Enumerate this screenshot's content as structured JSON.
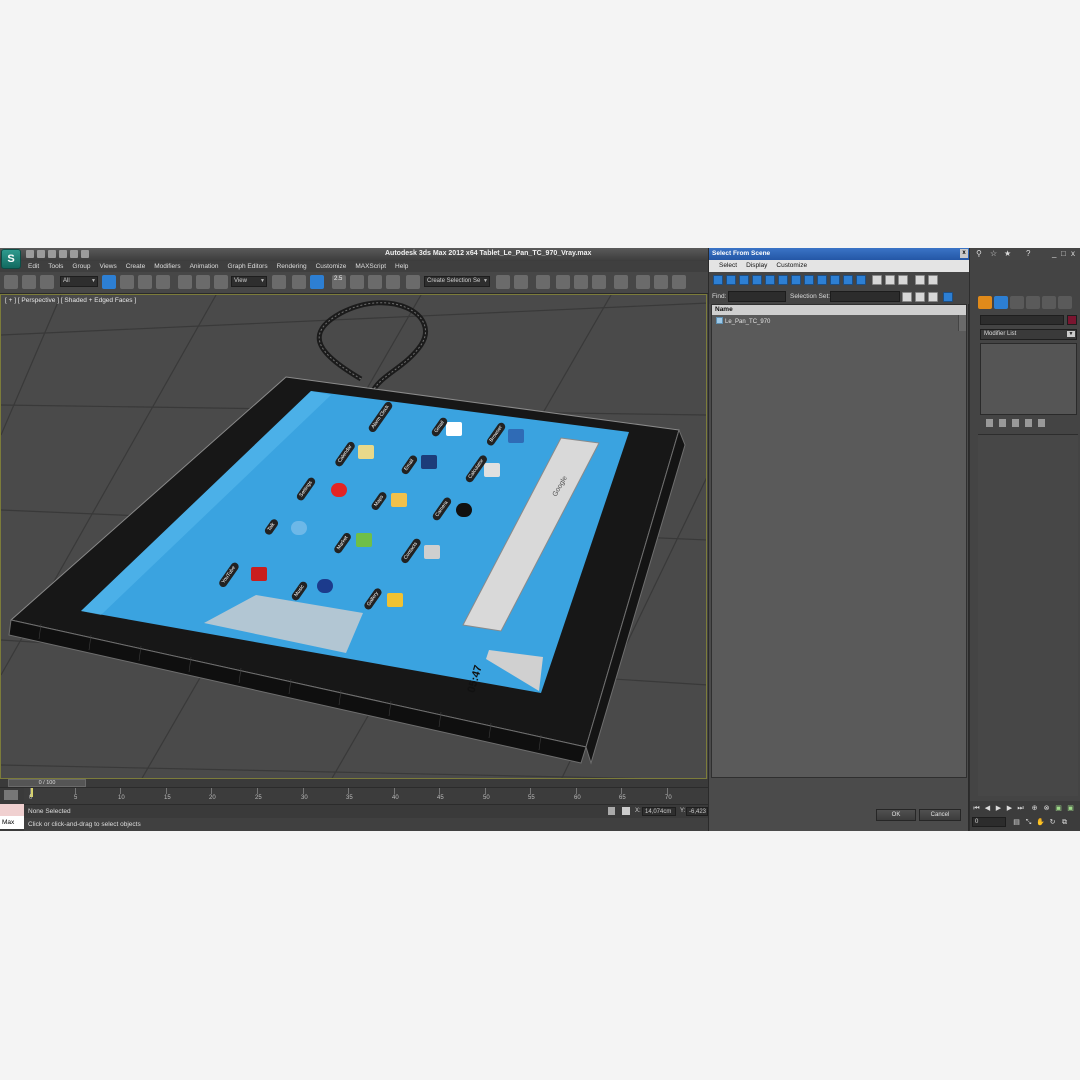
{
  "window": {
    "title": "Autodesk 3ds Max  2012 x64     Tablet_Le_Pan_TC_970_Vray.max",
    "logo_glyph": "S"
  },
  "menu": [
    "Edit",
    "Tools",
    "Group",
    "Views",
    "Create",
    "Modifiers",
    "Animation",
    "Graph Editors",
    "Rendering",
    "Customize",
    "MAXScript",
    "Help"
  ],
  "toolbar": {
    "filter_value": "All",
    "refcoord_value": "View",
    "selection_set_placeholder": "Create Selection Se",
    "snap_label": "2.5"
  },
  "viewport": {
    "label": "[ + ] [ Perspective ] [ Shaded + Edged Faces ]"
  },
  "tablet_screen": {
    "apps": [
      "Alarm Clock",
      "Gmail",
      "Browser",
      "Calculator",
      "Calendar",
      "Camera",
      "Contacts",
      "Email",
      "Gallery",
      "Maps",
      "Music",
      "Talk",
      "YouTube",
      "Settings",
      "Market"
    ],
    "clock": "05:47",
    "search_hint": "Google"
  },
  "timeline": {
    "slider_label": "0 / 100",
    "ticks": [
      "0",
      "5",
      "10",
      "15",
      "20",
      "25",
      "30",
      "35",
      "40",
      "45",
      "50",
      "55",
      "60",
      "65",
      "70"
    ]
  },
  "status": {
    "selection": "None Selected",
    "prompt": "Click or click-and-drag to select objects",
    "x_label": "X:",
    "x_value": "14,074cm",
    "y_label": "Y:",
    "y_value": "-6,423",
    "listener_label": "Max"
  },
  "dialog": {
    "title": "Select From Scene",
    "close_glyph": "x",
    "menu": [
      "Select",
      "Display",
      "Customize"
    ],
    "find_label": "Find:",
    "selection_set_label": "Selection Set:",
    "column_name": "Name",
    "items": [
      "Le_Pan_TC_970"
    ],
    "ok_label": "OK",
    "cancel_label": "Cancel"
  },
  "command_panel": {
    "modifier_list_label": "Modifier List",
    "frame_value": "0",
    "help_glyph": "?",
    "win_controls": [
      "_",
      "□",
      "x"
    ]
  },
  "colors": {
    "accent": "#2d7fd3",
    "screen_blue": "#3aa3e0",
    "object_color": "#7a1530"
  }
}
